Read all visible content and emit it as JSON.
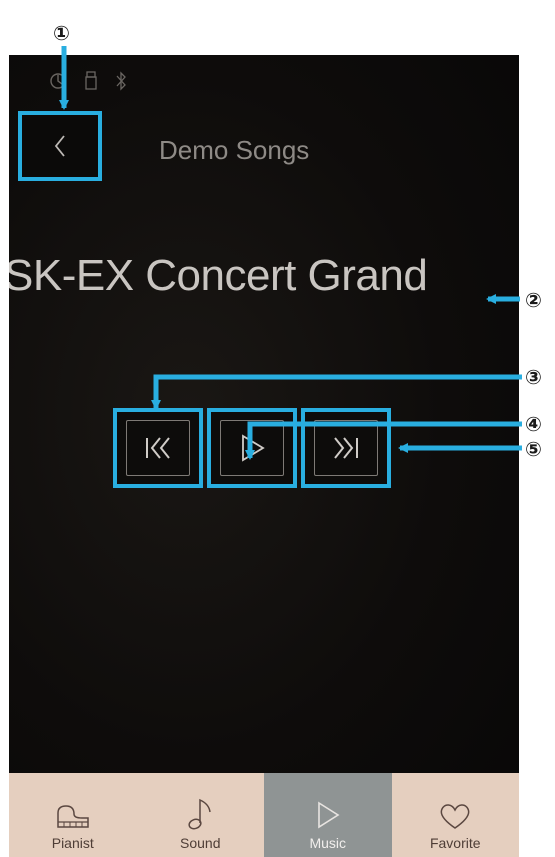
{
  "screen": {
    "title": "Demo Songs",
    "song_title": "SK-EX Concert Grand",
    "status_icons": [
      "recorder-icon",
      "usb-icon",
      "bluetooth-icon"
    ],
    "back_icon": "chevron-left-icon"
  },
  "controls": [
    {
      "name": "previous-song-button",
      "icon": "skip-previous-icon"
    },
    {
      "name": "play-button",
      "icon": "play-icon"
    },
    {
      "name": "next-song-button",
      "icon": "skip-next-icon"
    }
  ],
  "bottom_nav": {
    "items": [
      {
        "label": "Pianist",
        "icon": "grand-piano-icon",
        "active": false
      },
      {
        "label": "Sound",
        "icon": "music-note-icon",
        "active": false
      },
      {
        "label": "Music",
        "icon": "play-icon",
        "active": true
      },
      {
        "label": "Favorite",
        "icon": "heart-icon",
        "active": false
      }
    ]
  },
  "callouts": {
    "numbers": [
      "①",
      "②",
      "③",
      "④",
      "⑤"
    ]
  },
  "colors": {
    "highlight": "#29aee0",
    "nav_background": "#e5cfbf",
    "nav_active": "#8f9494",
    "screen_background": "#0e0c0b"
  }
}
